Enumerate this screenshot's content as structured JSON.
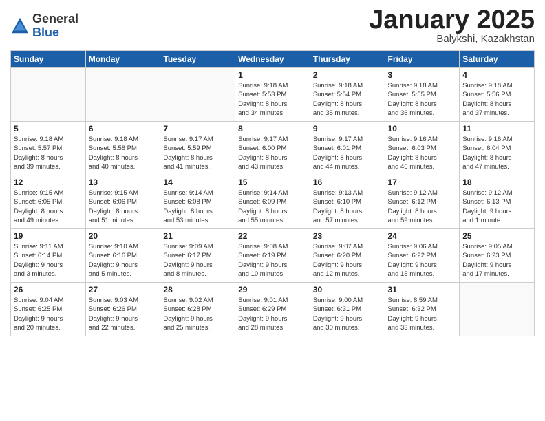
{
  "logo": {
    "general": "General",
    "blue": "Blue"
  },
  "header": {
    "title": "January 2025",
    "subtitle": "Balykshi, Kazakhstan"
  },
  "days_of_week": [
    "Sunday",
    "Monday",
    "Tuesday",
    "Wednesday",
    "Thursday",
    "Friday",
    "Saturday"
  ],
  "weeks": [
    [
      {
        "day": "",
        "info": ""
      },
      {
        "day": "",
        "info": ""
      },
      {
        "day": "",
        "info": ""
      },
      {
        "day": "1",
        "info": "Sunrise: 9:18 AM\nSunset: 5:53 PM\nDaylight: 8 hours\nand 34 minutes."
      },
      {
        "day": "2",
        "info": "Sunrise: 9:18 AM\nSunset: 5:54 PM\nDaylight: 8 hours\nand 35 minutes."
      },
      {
        "day": "3",
        "info": "Sunrise: 9:18 AM\nSunset: 5:55 PM\nDaylight: 8 hours\nand 36 minutes."
      },
      {
        "day": "4",
        "info": "Sunrise: 9:18 AM\nSunset: 5:56 PM\nDaylight: 8 hours\nand 37 minutes."
      }
    ],
    [
      {
        "day": "5",
        "info": "Sunrise: 9:18 AM\nSunset: 5:57 PM\nDaylight: 8 hours\nand 39 minutes."
      },
      {
        "day": "6",
        "info": "Sunrise: 9:18 AM\nSunset: 5:58 PM\nDaylight: 8 hours\nand 40 minutes."
      },
      {
        "day": "7",
        "info": "Sunrise: 9:17 AM\nSunset: 5:59 PM\nDaylight: 8 hours\nand 41 minutes."
      },
      {
        "day": "8",
        "info": "Sunrise: 9:17 AM\nSunset: 6:00 PM\nDaylight: 8 hours\nand 43 minutes."
      },
      {
        "day": "9",
        "info": "Sunrise: 9:17 AM\nSunset: 6:01 PM\nDaylight: 8 hours\nand 44 minutes."
      },
      {
        "day": "10",
        "info": "Sunrise: 9:16 AM\nSunset: 6:03 PM\nDaylight: 8 hours\nand 46 minutes."
      },
      {
        "day": "11",
        "info": "Sunrise: 9:16 AM\nSunset: 6:04 PM\nDaylight: 8 hours\nand 47 minutes."
      }
    ],
    [
      {
        "day": "12",
        "info": "Sunrise: 9:15 AM\nSunset: 6:05 PM\nDaylight: 8 hours\nand 49 minutes."
      },
      {
        "day": "13",
        "info": "Sunrise: 9:15 AM\nSunset: 6:06 PM\nDaylight: 8 hours\nand 51 minutes."
      },
      {
        "day": "14",
        "info": "Sunrise: 9:14 AM\nSunset: 6:08 PM\nDaylight: 8 hours\nand 53 minutes."
      },
      {
        "day": "15",
        "info": "Sunrise: 9:14 AM\nSunset: 6:09 PM\nDaylight: 8 hours\nand 55 minutes."
      },
      {
        "day": "16",
        "info": "Sunrise: 9:13 AM\nSunset: 6:10 PM\nDaylight: 8 hours\nand 57 minutes."
      },
      {
        "day": "17",
        "info": "Sunrise: 9:12 AM\nSunset: 6:12 PM\nDaylight: 8 hours\nand 59 minutes."
      },
      {
        "day": "18",
        "info": "Sunrise: 9:12 AM\nSunset: 6:13 PM\nDaylight: 9 hours\nand 1 minute."
      }
    ],
    [
      {
        "day": "19",
        "info": "Sunrise: 9:11 AM\nSunset: 6:14 PM\nDaylight: 9 hours\nand 3 minutes."
      },
      {
        "day": "20",
        "info": "Sunrise: 9:10 AM\nSunset: 6:16 PM\nDaylight: 9 hours\nand 5 minutes."
      },
      {
        "day": "21",
        "info": "Sunrise: 9:09 AM\nSunset: 6:17 PM\nDaylight: 9 hours\nand 8 minutes."
      },
      {
        "day": "22",
        "info": "Sunrise: 9:08 AM\nSunset: 6:19 PM\nDaylight: 9 hours\nand 10 minutes."
      },
      {
        "day": "23",
        "info": "Sunrise: 9:07 AM\nSunset: 6:20 PM\nDaylight: 9 hours\nand 12 minutes."
      },
      {
        "day": "24",
        "info": "Sunrise: 9:06 AM\nSunset: 6:22 PM\nDaylight: 9 hours\nand 15 minutes."
      },
      {
        "day": "25",
        "info": "Sunrise: 9:05 AM\nSunset: 6:23 PM\nDaylight: 9 hours\nand 17 minutes."
      }
    ],
    [
      {
        "day": "26",
        "info": "Sunrise: 9:04 AM\nSunset: 6:25 PM\nDaylight: 9 hours\nand 20 minutes."
      },
      {
        "day": "27",
        "info": "Sunrise: 9:03 AM\nSunset: 6:26 PM\nDaylight: 9 hours\nand 22 minutes."
      },
      {
        "day": "28",
        "info": "Sunrise: 9:02 AM\nSunset: 6:28 PM\nDaylight: 9 hours\nand 25 minutes."
      },
      {
        "day": "29",
        "info": "Sunrise: 9:01 AM\nSunset: 6:29 PM\nDaylight: 9 hours\nand 28 minutes."
      },
      {
        "day": "30",
        "info": "Sunrise: 9:00 AM\nSunset: 6:31 PM\nDaylight: 9 hours\nand 30 minutes."
      },
      {
        "day": "31",
        "info": "Sunrise: 8:59 AM\nSunset: 6:32 PM\nDaylight: 9 hours\nand 33 minutes."
      },
      {
        "day": "",
        "info": ""
      }
    ]
  ]
}
